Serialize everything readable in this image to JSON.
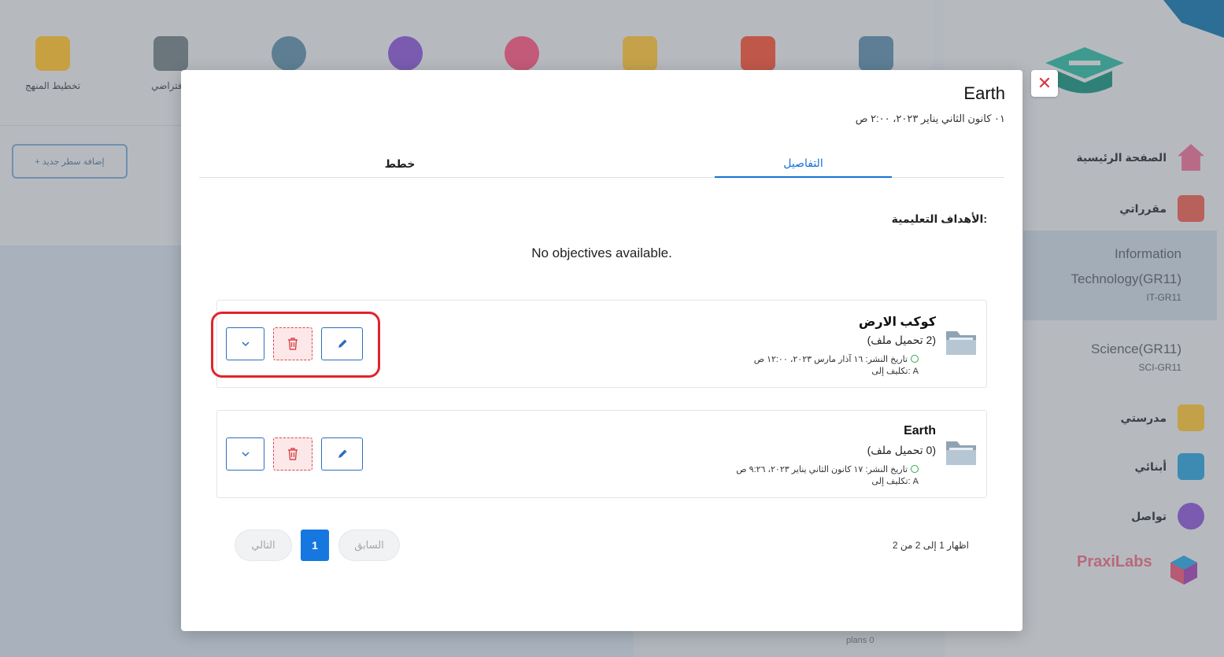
{
  "background": {
    "toolbar": [
      {
        "label": "تخطيط المنهج",
        "icon": "curriculum-icon",
        "color": "#c7a042"
      },
      {
        "label": "الافتراضي",
        "icon": "virtual-class-icon",
        "color": "#6a757c"
      },
      {
        "label": "",
        "icon": "users-icon",
        "color": "#5e7f93"
      },
      {
        "label": "",
        "icon": "chat-icon",
        "color": "#7a5bb0"
      },
      {
        "label": "",
        "icon": "location-icon",
        "color": "#c35a7a"
      },
      {
        "label": "",
        "icon": "assignment-icon",
        "color": "#c5a14a"
      },
      {
        "label": "",
        "icon": "book-icon",
        "color": "#c0584a"
      },
      {
        "label": "",
        "icon": "announcement-icon",
        "color": "#5d7e94"
      }
    ],
    "add_row_button": "+ إضافة سطر جديد",
    "sidebar": {
      "items": [
        {
          "label": "الصفحة الرئيسية",
          "icon": "home-icon",
          "color": "#b86b86"
        },
        {
          "label": "مقرراتي",
          "icon": "courses-icon",
          "color": "#b8605a"
        },
        {
          "label": "مدرستي",
          "icon": "school-icon",
          "color": "#c3a148"
        },
        {
          "label": "أبنائي",
          "icon": "calendar-icon",
          "color": "#3d8bb3"
        },
        {
          "label": "تواصل",
          "icon": "messages-icon",
          "color": "#7a5bb0"
        }
      ],
      "courses": [
        {
          "name_line1": "Information",
          "name_line2": "Technology(GR11)",
          "code": "IT-GR11"
        },
        {
          "name_line1": "Science(GR11)",
          "name_line2": "",
          "code": "SCI-GR11"
        }
      ],
      "praxilabs": "PraxiLabs"
    },
    "plans_text": "plans 0"
  },
  "modal": {
    "title": "Earth",
    "date": "٠١ كانون الثاني يناير ٢٠٢٣، ٢:٠٠ ص",
    "close_symbol": "✕",
    "tabs": [
      {
        "label": "التفاصيل",
        "active": true
      },
      {
        "label": "خطط",
        "active": false
      }
    ],
    "objectives_label": "الأهداف التعليمية:",
    "no_objectives": "No objectives available.",
    "items": [
      {
        "title": "كوكب الارض",
        "files": "(2 تحميل ملف)",
        "published": "تاريخ النشر: ١٦ آذار مارس ٢٠٢٣، ١٢:٠٠ ص",
        "assigned": "تكليف إلى: A"
      },
      {
        "title": "Earth",
        "files": "(0 تحميل ملف)",
        "published": "تاريخ النشر: ١٧ كانون الثاني يناير ٢٠٢٣، ٩:٢٦ ص",
        "assigned": "تكليف إلى: A"
      }
    ],
    "pagination": {
      "showing": "اظهار 1 إلى 2 من 2",
      "previous": "السابق",
      "current": "1",
      "next": "التالي"
    }
  },
  "colors": {
    "primary": "#1677e0",
    "danger": "#d8464e",
    "highlight": "#e0242c"
  }
}
